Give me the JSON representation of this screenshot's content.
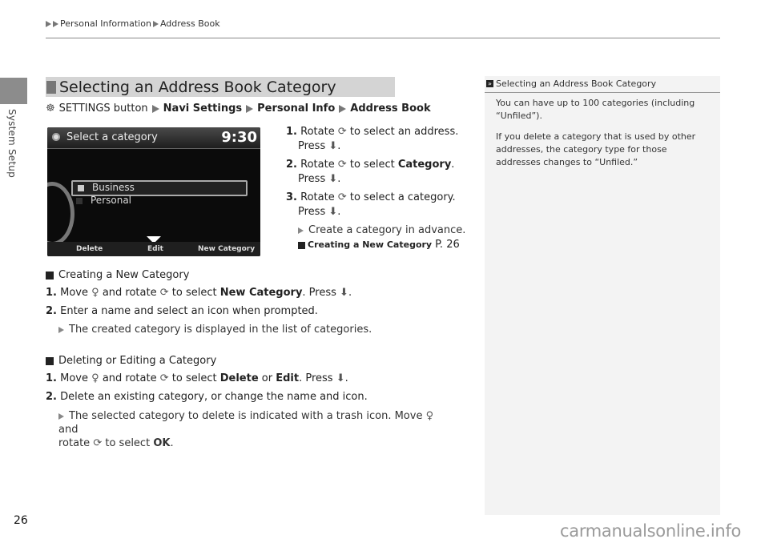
{
  "breadcrumb": {
    "items": [
      "Personal Information",
      "Address Book"
    ]
  },
  "side_tab": {
    "label": "System Setup"
  },
  "section": {
    "title": "Selecting an Address Book Category"
  },
  "nav_path": {
    "prefix": "SETTINGS button",
    "items": [
      "Navi Settings",
      "Personal Info",
      "Address Book"
    ]
  },
  "screen": {
    "title": "Select a category",
    "clock": "9:30",
    "list": [
      "Business",
      "Personal"
    ],
    "selected_index": 0,
    "softkeys": [
      "Delete",
      "Edit",
      "New Category"
    ]
  },
  "steps": [
    {
      "num": "1.",
      "pre": "Rotate",
      "post": "to select an address.",
      "press": "Press"
    },
    {
      "num": "2.",
      "pre": "Rotate",
      "post_plain": "to select",
      "bold": "Category",
      "tail": ".",
      "press": "Press"
    },
    {
      "num": "3.",
      "pre": "Rotate",
      "post": "to select a category.",
      "press": "Press"
    }
  ],
  "step_note": "Create a category in advance.",
  "step_xref": {
    "label": "Creating a New Category",
    "page": "P. 26"
  },
  "creating": {
    "heading": "Creating a New Category",
    "line1": {
      "num": "1.",
      "a": "Move",
      "b": "and rotate",
      "c": "to select",
      "bold": "New Category",
      "d": ". Press",
      "e": "."
    },
    "line2": {
      "num": "2.",
      "text": "Enter a name and select an icon when prompted."
    },
    "note": "The created category is displayed in the list of categories."
  },
  "deleting": {
    "heading": "Deleting or Editing a Category",
    "line1": {
      "num": "1.",
      "a": "Move",
      "b": "and rotate",
      "c": "to select",
      "bold1": "Delete",
      "or": "or",
      "bold2": "Edit",
      "d": ". Press",
      "e": "."
    },
    "line2": {
      "num": "2.",
      "text": "Delete an existing category, or change the name and icon."
    },
    "note_a": "The selected category to delete is indicated with a trash icon. Move",
    "note_b": "and",
    "note_c": "rotate",
    "note_d": "to select",
    "note_bold": "OK",
    "note_e": "."
  },
  "sidebar": {
    "title": "Selecting an Address Book Category",
    "paragraphs": [
      "You can have up to 100 categories (including “Unfiled”).",
      "If you delete a category that is used by other addresses, the category type for those addresses changes to “Unfiled.”"
    ]
  },
  "footer": {
    "page_number": "26",
    "watermark": "carmanualsonline.info"
  },
  "glyphs": {
    "rotate": "⟳",
    "press": "⬇",
    "move": "♀",
    "settings": "☸"
  }
}
